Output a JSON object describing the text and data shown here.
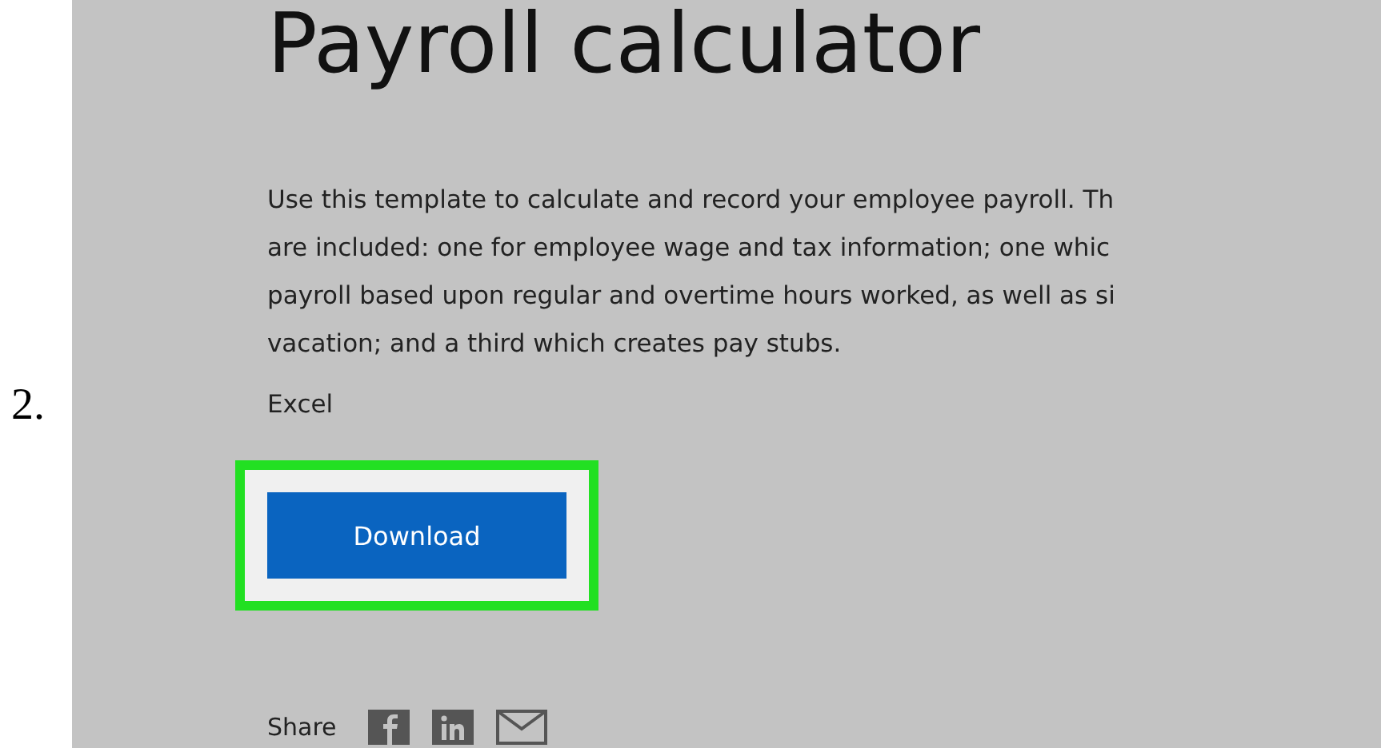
{
  "step_number": "2.",
  "page": {
    "title": "Payroll calculator",
    "description_lines": [
      "Use this template to calculate and record your employee payroll. Th",
      "are included: one for employee wage and tax information; one whic",
      "payroll based upon regular and overtime hours worked, as well as si",
      "vacation; and a third which creates pay stubs."
    ],
    "file_type": "Excel",
    "download_button": {
      "label": "Download",
      "highlighted": true
    },
    "share": {
      "label": "Share"
    }
  }
}
